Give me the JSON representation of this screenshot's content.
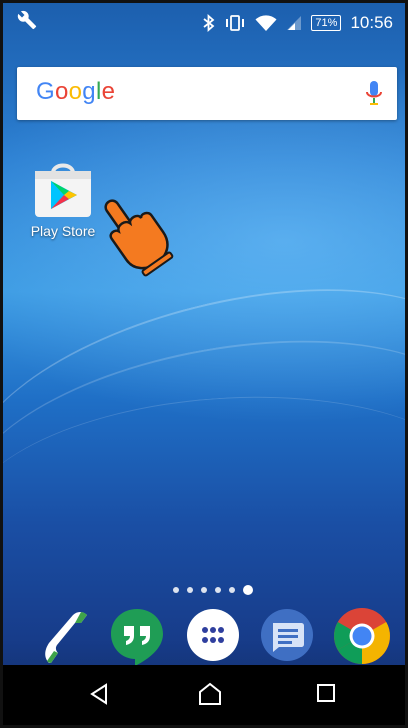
{
  "status_bar": {
    "battery_level": "71%",
    "time": "10:56",
    "icons": [
      "wrench-icon",
      "bluetooth-icon",
      "vibrate-icon",
      "wifi-icon",
      "signal-icon"
    ]
  },
  "search": {
    "logo_letters": [
      {
        "char": "G",
        "color": "#4285F4"
      },
      {
        "char": "o",
        "color": "#EA4335"
      },
      {
        "char": "o",
        "color": "#FBBC05"
      },
      {
        "char": "g",
        "color": "#4285F4"
      },
      {
        "char": "l",
        "color": "#34A853"
      },
      {
        "char": "e",
        "color": "#EA4335"
      }
    ],
    "mic_icon": "mic-icon"
  },
  "home": {
    "apps": [
      {
        "label": "Play Store",
        "icon": "play-store-icon"
      }
    ],
    "pointer_icon": "pointing-hand-icon"
  },
  "page_indicator": {
    "count": 6,
    "active_index": 5
  },
  "dock": {
    "items": [
      {
        "icon": "phone-icon"
      },
      {
        "icon": "hangouts-icon"
      },
      {
        "icon": "app-drawer-icon"
      },
      {
        "icon": "messaging-icon"
      },
      {
        "icon": "chrome-icon"
      }
    ]
  },
  "nav_bar": {
    "buttons": [
      {
        "icon": "back-icon"
      },
      {
        "icon": "home-icon"
      },
      {
        "icon": "recents-icon"
      }
    ]
  }
}
